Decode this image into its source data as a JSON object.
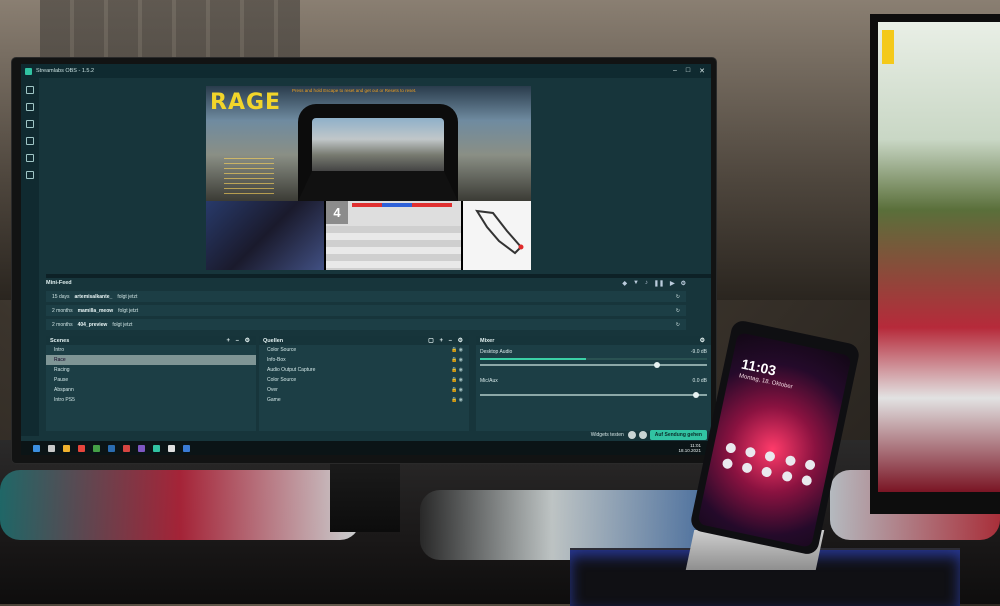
{
  "app": {
    "title": "Streamlabs OBS - 1.5.2",
    "window_controls": [
      "–",
      "□",
      "✕"
    ]
  },
  "preview": {
    "logo_text": "RAGE",
    "banner_text": "Press and hold Escape to reset and get out or Resets to reset.",
    "position": "4"
  },
  "mini_feed": {
    "title": "Mini-Feed",
    "items": [
      {
        "age": "15 days",
        "name": "artemisalkante_",
        "action": "folgt jetzt"
      },
      {
        "age": "2 months",
        "name": "mamilla_meow",
        "action": "folgt jetzt"
      },
      {
        "age": "2 months",
        "name": "404_preview",
        "action": "folgt jetzt"
      }
    ]
  },
  "scenes": {
    "title": "Scenes",
    "items": [
      "Intro",
      "Race",
      "Racing",
      "Pause",
      "Abspann",
      "Intro PS5"
    ],
    "selected_index": 1
  },
  "sources": {
    "title": "Quellen",
    "items": [
      "Color Source",
      "Info-Box",
      "Audio Output Capture",
      "Color Source",
      "Over",
      "Game"
    ]
  },
  "mixer": {
    "title": "Mixer",
    "channels": [
      {
        "name": "Desktop Audio",
        "db": "-9.0 dB",
        "level": 0.78
      },
      {
        "name": "Mic/Aux",
        "db": "0.0 dB",
        "level": 0.95
      }
    ]
  },
  "footer": {
    "widgets_label": "Widgets testen",
    "go_live_label": "Auf Sendung gehen"
  },
  "taskbar": {
    "time": "11:01",
    "date": "18.10.2021"
  },
  "phone": {
    "time": "11:03",
    "date": "Montag, 18. Oktober"
  },
  "colors": {
    "obs_bg": "#17353b",
    "accent": "#31c3a2",
    "rage_yellow": "#f2d52a"
  }
}
